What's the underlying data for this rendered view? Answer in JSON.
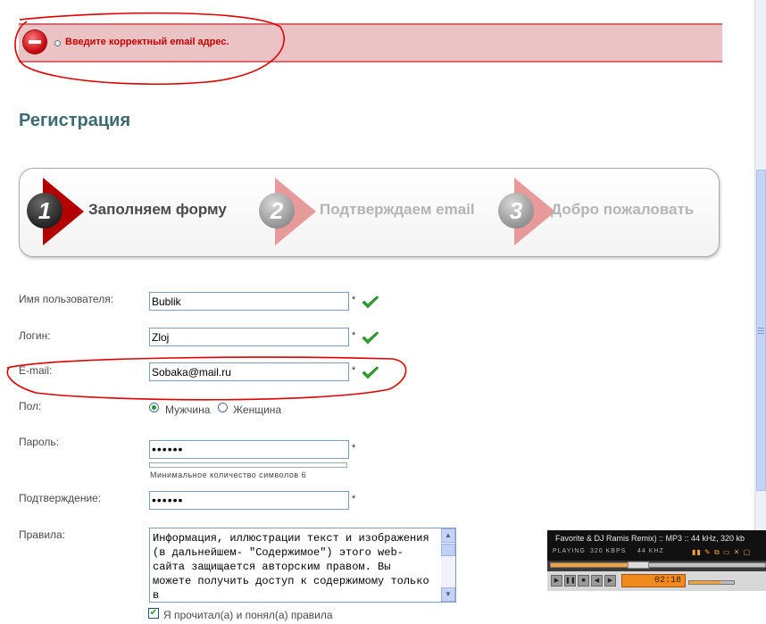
{
  "error": {
    "message": "Введите корректный email адрес."
  },
  "page_title": "Регистрация",
  "steps": [
    {
      "num": "1",
      "label": "Заполняем форму"
    },
    {
      "num": "2",
      "label": "Подтверждаем email"
    },
    {
      "num": "3",
      "label": "Добро  пожаловать"
    }
  ],
  "form": {
    "username": {
      "label": "Имя пользователя:",
      "value": "Bublik",
      "required": "*"
    },
    "login": {
      "label": "Логин:",
      "value": "Zloj",
      "required": "*"
    },
    "email": {
      "label": "E-mail:",
      "value": "Sobaka@mail.ru",
      "required": "*"
    },
    "gender": {
      "label": "Пол:",
      "options": [
        "Мужчина",
        "Женщина"
      ],
      "selected": "Мужчина"
    },
    "password": {
      "label": "Пароль:",
      "value": "••••••",
      "required": "*",
      "hint": "Минимальное количество символов 6"
    },
    "confirm": {
      "label": "Подтверждение:",
      "value": "••••••",
      "required": "*"
    },
    "rules": {
      "label": "Правила:",
      "text": "Информация, иллюстрации текст и изображения (в дальнейшем- \"Содержимое\") этого web-сайта защищается авторским правом. Вы можете получить доступ к содержимому только в"
    },
    "agree": {
      "label": "Я прочитал(а) и понял(а) правила",
      "checked": true
    }
  },
  "player": {
    "title": "Favorite & DJ Ramis Remix) :: MP3 :: 44 kHz, 320 kb",
    "status": "PLAYING",
    "bitrate": "320 KBPS",
    "samplerate": "44 KHZ",
    "time": "02:18",
    "volume_label": "VOLUME"
  },
  "colors": {
    "error_bg": "#ecc3c5",
    "error_text": "#c00000",
    "title": "#3c6b70",
    "active_arrow": "#b30000",
    "inactive_arrow": "#e69a9a",
    "annotation": "#e00000",
    "valid_check": "#2fa52f"
  }
}
